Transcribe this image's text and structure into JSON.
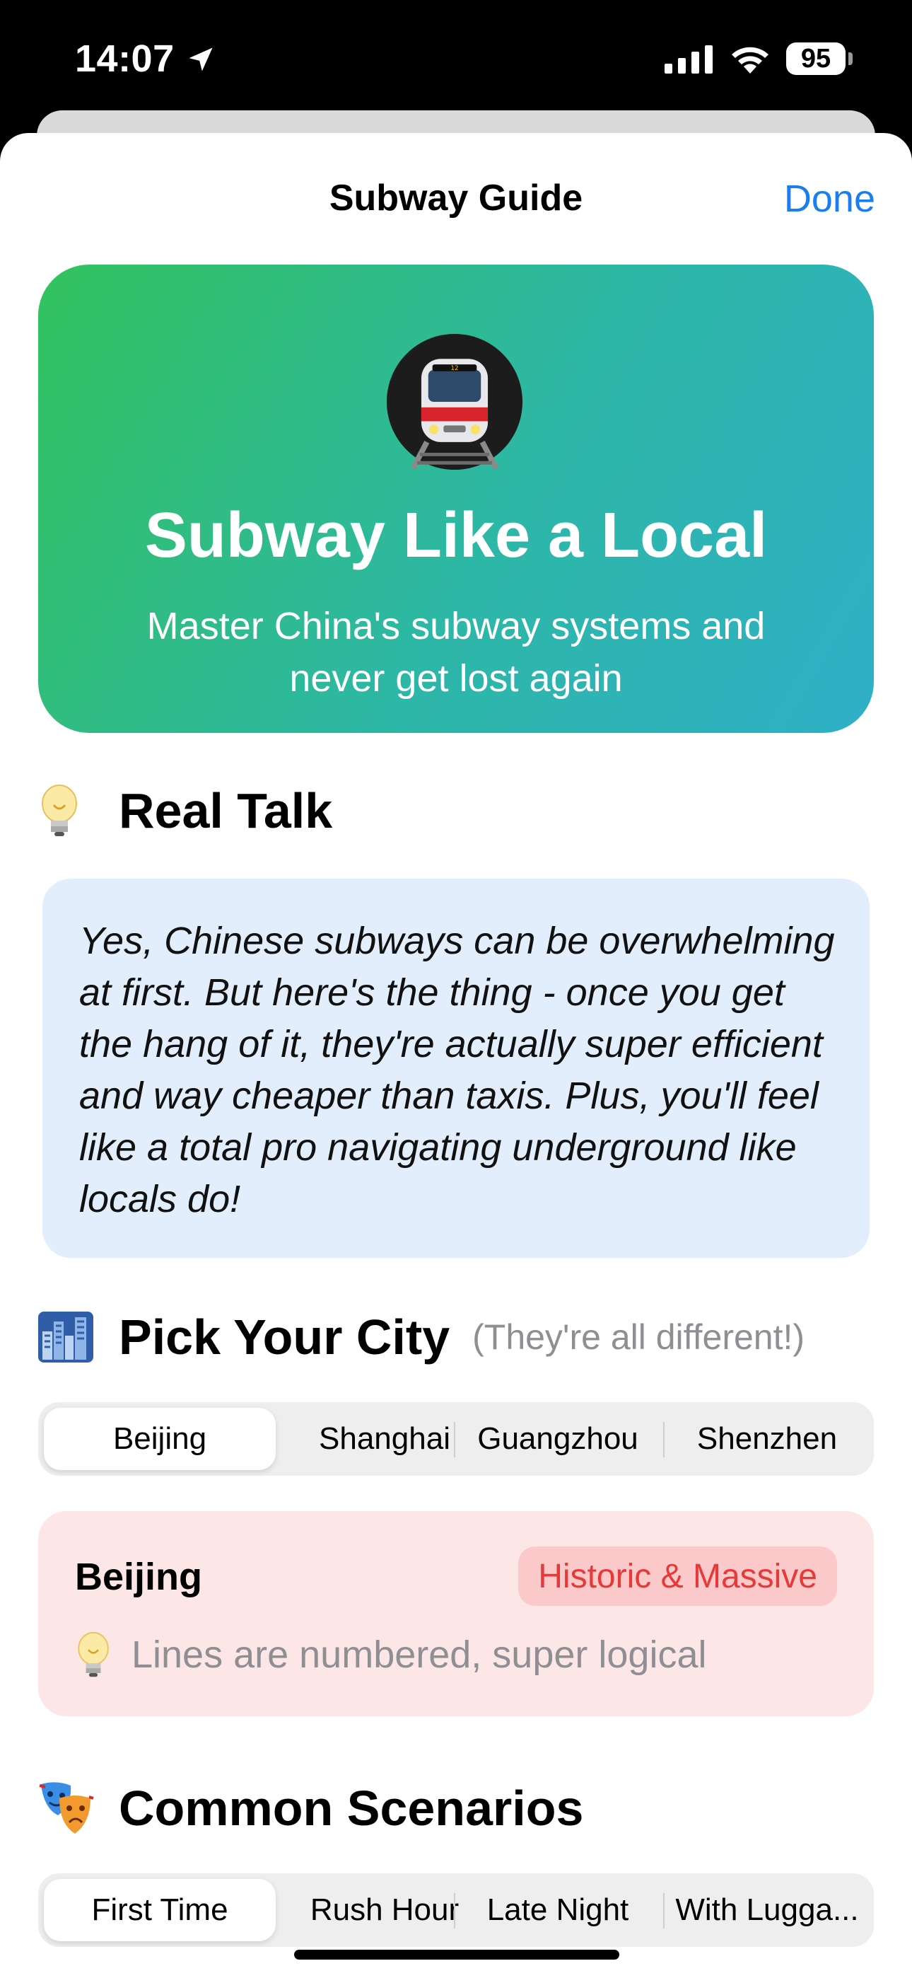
{
  "status_bar": {
    "time": "14:07",
    "battery": "95"
  },
  "nav": {
    "title": "Subway Guide",
    "done_label": "Done"
  },
  "hero": {
    "title": "Subway Like a Local",
    "subtitle": "Master China's subway systems and never get lost again"
  },
  "real_talk": {
    "title": "Real Talk",
    "body": "Yes, Chinese subways can be overwhelming at first. But here's the thing - once you get the hang of it, they're actually super efficient and way cheaper than taxis. Plus, you'll feel like a total pro navigating underground like locals do!"
  },
  "city_section": {
    "title": "Pick Your City",
    "hint": "(They're all different!)",
    "tabs": [
      {
        "label": "Beijing",
        "selected": true
      },
      {
        "label": "Shanghai",
        "selected": false
      },
      {
        "label": "Guangzhou",
        "selected": false
      },
      {
        "label": "Shenzhen",
        "selected": false
      }
    ],
    "card": {
      "name": "Beijing",
      "badge": "Historic & Massive",
      "tip": "Lines are numbered, super logical"
    }
  },
  "scenario_section": {
    "title": "Common Scenarios",
    "tabs": [
      {
        "label": "First Time",
        "selected": true
      },
      {
        "label": "Rush Hour",
        "selected": false
      },
      {
        "label": "Late Night",
        "selected": false
      },
      {
        "label": "With Lugga...",
        "selected": false
      }
    ]
  },
  "colors": {
    "accent": "#1a7ef2",
    "hero_gradient_start": "#33c25e",
    "hero_gradient_end": "#2fb0c8",
    "talk_bg": "#e2eefc",
    "card_bg": "#fde6e6",
    "badge_text": "#e63a3a"
  },
  "icons": {
    "hero": "metro-train-icon",
    "real_talk": "lightbulb-icon",
    "city": "cityscape-icon",
    "scenarios": "theater-masks-icon",
    "tip": "lightbulb-icon"
  }
}
